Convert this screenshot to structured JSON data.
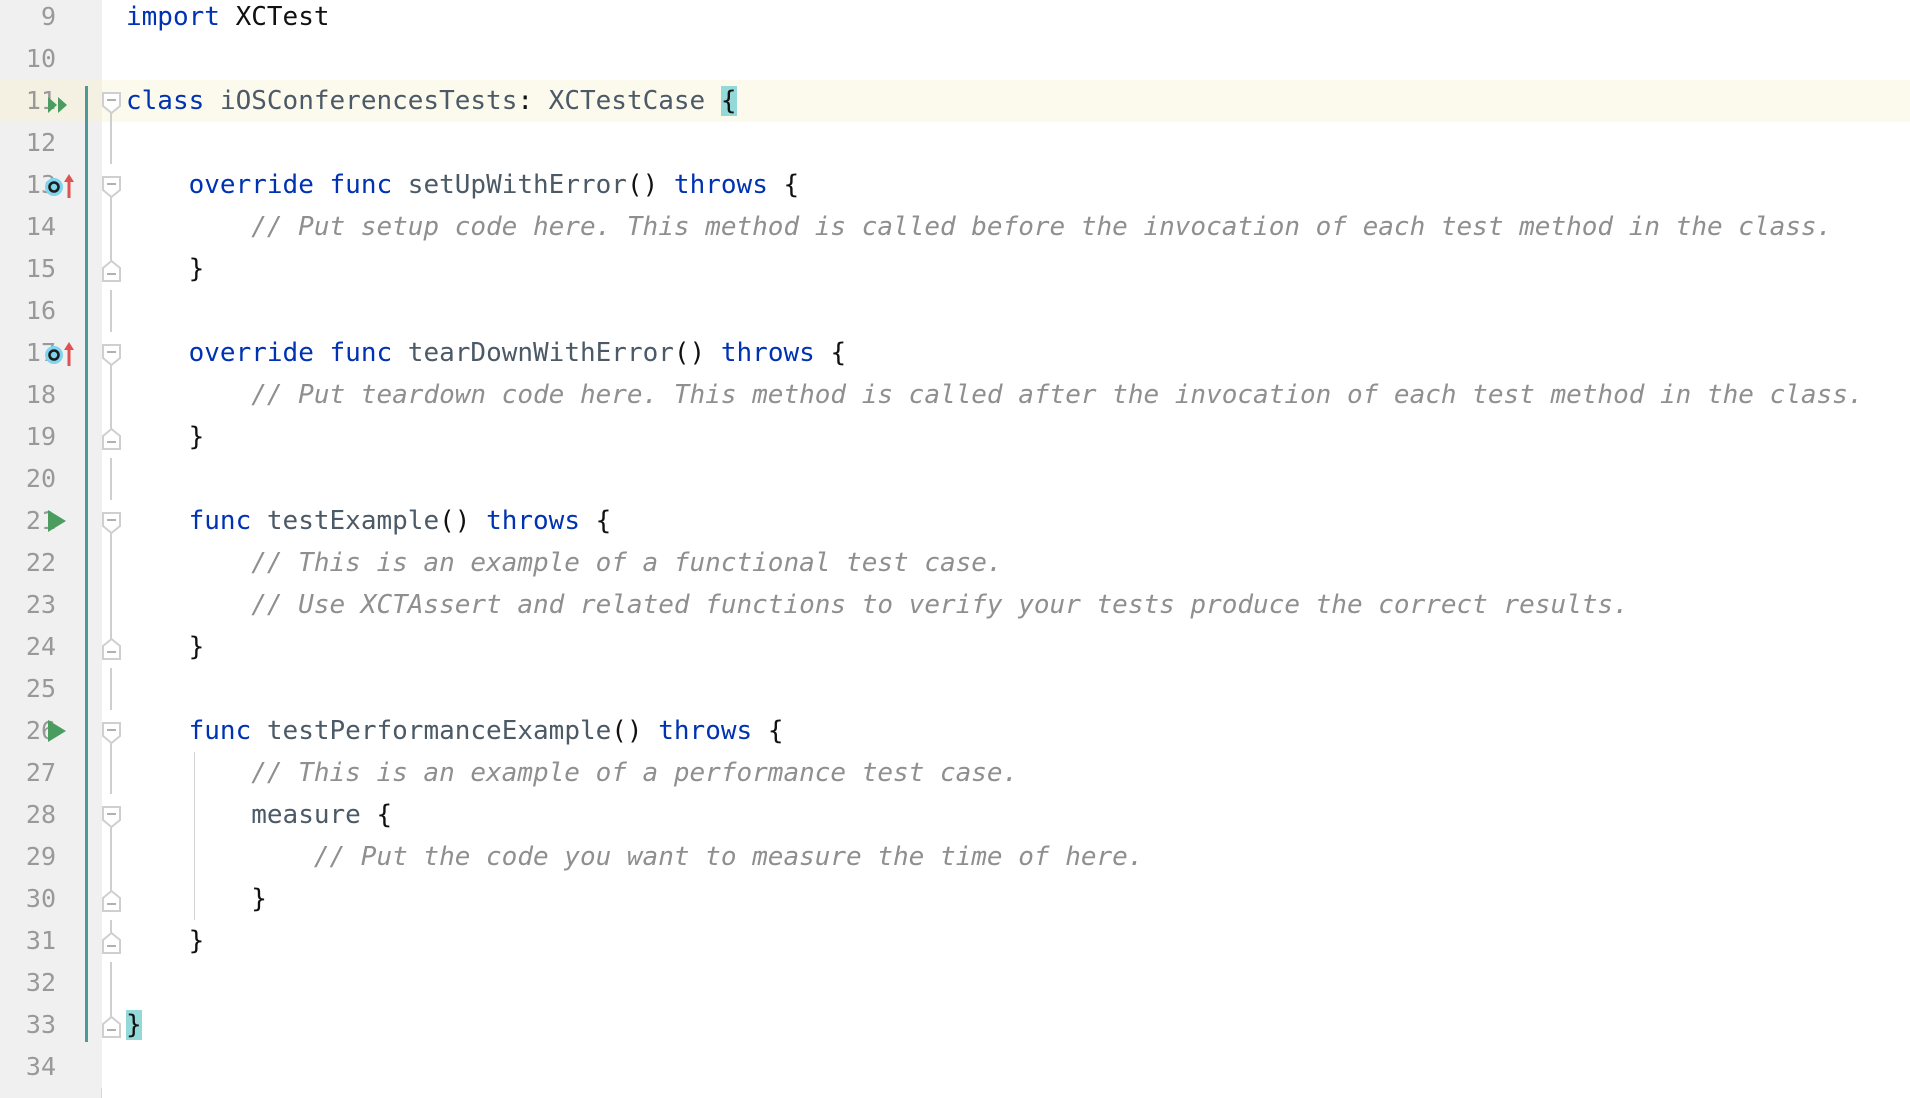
{
  "editor": {
    "language": "Swift",
    "first_visible_line": 9,
    "last_visible_line": 34,
    "current_line": 11,
    "colors": {
      "gutter_bg": "#f0f0f0",
      "code_bg": "#ffffff",
      "line_number": "#999999",
      "keyword": "#0033b3",
      "identifier": "#4b5a66",
      "comment": "#8f8f8f",
      "current_line_highlight": "#fcfaed",
      "matching_brace_highlight": "#93d9d9",
      "vcs_change_marker": "#4a9a9a",
      "fold_marker": "#cfcfcf",
      "run_icon_green": "#4a9c5f",
      "override_icon_cyan": "#59c3e3",
      "override_arrow_red": "#e05252"
    }
  },
  "lines": [
    {
      "number": "9",
      "indent": 0,
      "icon": null,
      "fold": null,
      "vcs": false,
      "current": false,
      "tokens": [
        {
          "t": "import",
          "c": "kw"
        },
        {
          "t": " ",
          "c": "plain"
        },
        {
          "t": "XCTest",
          "c": "plain"
        }
      ]
    },
    {
      "number": "10",
      "indent": 0,
      "icon": null,
      "fold": null,
      "vcs": false,
      "current": false,
      "tokens": []
    },
    {
      "number": "11",
      "indent": 0,
      "icon": "run-all-tests-icon",
      "fold": "start",
      "vcs": true,
      "current": true,
      "tokens": [
        {
          "t": "class",
          "c": "kw"
        },
        {
          "t": " ",
          "c": "plain"
        },
        {
          "t": "iOSConferencesTests",
          "c": "id"
        },
        {
          "t": ":",
          "c": "punc"
        },
        {
          "t": " ",
          "c": "plain"
        },
        {
          "t": "XCTestCase",
          "c": "type"
        },
        {
          "t": " ",
          "c": "plain"
        },
        {
          "t": "{",
          "c": "brace-hl"
        }
      ]
    },
    {
      "number": "12",
      "indent": 0,
      "icon": null,
      "fold": "mid",
      "vcs": true,
      "current": false,
      "tokens": []
    },
    {
      "number": "13",
      "indent": 0,
      "icon": "override-method-icon",
      "fold": "start",
      "vcs": true,
      "current": false,
      "tokens": [
        {
          "t": "    ",
          "c": "plain"
        },
        {
          "t": "override",
          "c": "kw"
        },
        {
          "t": " ",
          "c": "plain"
        },
        {
          "t": "func",
          "c": "kw"
        },
        {
          "t": " ",
          "c": "plain"
        },
        {
          "t": "setUpWithError",
          "c": "id"
        },
        {
          "t": "()",
          "c": "punc"
        },
        {
          "t": " ",
          "c": "plain"
        },
        {
          "t": "throws",
          "c": "kw"
        },
        {
          "t": " ",
          "c": "plain"
        },
        {
          "t": "{",
          "c": "punc"
        }
      ]
    },
    {
      "number": "14",
      "indent": 0,
      "icon": null,
      "fold": "mid",
      "vcs": true,
      "current": false,
      "tokens": [
        {
          "t": "        // Put setup code here. This method is called before the invocation of each test method in the class.",
          "c": "cm"
        }
      ]
    },
    {
      "number": "15",
      "indent": 0,
      "icon": null,
      "fold": "end",
      "vcs": true,
      "current": false,
      "tokens": [
        {
          "t": "    ",
          "c": "plain"
        },
        {
          "t": "}",
          "c": "punc"
        }
      ]
    },
    {
      "number": "16",
      "indent": 0,
      "icon": null,
      "fold": "mid",
      "vcs": true,
      "current": false,
      "tokens": []
    },
    {
      "number": "17",
      "indent": 0,
      "icon": "override-method-icon",
      "fold": "start",
      "vcs": true,
      "current": false,
      "tokens": [
        {
          "t": "    ",
          "c": "plain"
        },
        {
          "t": "override",
          "c": "kw"
        },
        {
          "t": " ",
          "c": "plain"
        },
        {
          "t": "func",
          "c": "kw"
        },
        {
          "t": " ",
          "c": "plain"
        },
        {
          "t": "tearDownWithError",
          "c": "id"
        },
        {
          "t": "()",
          "c": "punc"
        },
        {
          "t": " ",
          "c": "plain"
        },
        {
          "t": "throws",
          "c": "kw"
        },
        {
          "t": " ",
          "c": "plain"
        },
        {
          "t": "{",
          "c": "punc"
        }
      ]
    },
    {
      "number": "18",
      "indent": 0,
      "icon": null,
      "fold": "mid",
      "vcs": true,
      "current": false,
      "tokens": [
        {
          "t": "        // Put teardown code here. This method is called after the invocation of each test method in the class.",
          "c": "cm"
        }
      ]
    },
    {
      "number": "19",
      "indent": 0,
      "icon": null,
      "fold": "end",
      "vcs": true,
      "current": false,
      "tokens": [
        {
          "t": "    ",
          "c": "plain"
        },
        {
          "t": "}",
          "c": "punc"
        }
      ]
    },
    {
      "number": "20",
      "indent": 0,
      "icon": null,
      "fold": "mid",
      "vcs": true,
      "current": false,
      "tokens": []
    },
    {
      "number": "21",
      "indent": 0,
      "icon": "run-test-icon",
      "fold": "start",
      "vcs": true,
      "current": false,
      "tokens": [
        {
          "t": "    ",
          "c": "plain"
        },
        {
          "t": "func",
          "c": "kw"
        },
        {
          "t": " ",
          "c": "plain"
        },
        {
          "t": "testExample",
          "c": "id"
        },
        {
          "t": "()",
          "c": "punc"
        },
        {
          "t": " ",
          "c": "plain"
        },
        {
          "t": "throws",
          "c": "kw"
        },
        {
          "t": " ",
          "c": "plain"
        },
        {
          "t": "{",
          "c": "punc"
        }
      ]
    },
    {
      "number": "22",
      "indent": 0,
      "icon": null,
      "fold": "mid",
      "vcs": true,
      "current": false,
      "tokens": [
        {
          "t": "        // This is an example of a functional test case.",
          "c": "cm"
        }
      ]
    },
    {
      "number": "23",
      "indent": 0,
      "icon": null,
      "fold": "mid",
      "vcs": true,
      "current": false,
      "tokens": [
        {
          "t": "        // Use XCTAssert and related functions to verify your tests produce the correct results.",
          "c": "cm"
        }
      ]
    },
    {
      "number": "24",
      "indent": 0,
      "icon": null,
      "fold": "end",
      "vcs": true,
      "current": false,
      "tokens": [
        {
          "t": "    ",
          "c": "plain"
        },
        {
          "t": "}",
          "c": "punc"
        }
      ]
    },
    {
      "number": "25",
      "indent": 0,
      "icon": null,
      "fold": "mid",
      "vcs": true,
      "current": false,
      "tokens": []
    },
    {
      "number": "26",
      "indent": 0,
      "icon": "run-test-icon",
      "fold": "start",
      "vcs": true,
      "current": false,
      "tokens": [
        {
          "t": "    ",
          "c": "plain"
        },
        {
          "t": "func",
          "c": "kw"
        },
        {
          "t": " ",
          "c": "plain"
        },
        {
          "t": "testPerformanceExample",
          "c": "id"
        },
        {
          "t": "()",
          "c": "punc"
        },
        {
          "t": " ",
          "c": "plain"
        },
        {
          "t": "throws",
          "c": "kw"
        },
        {
          "t": " ",
          "c": "plain"
        },
        {
          "t": "{",
          "c": "punc"
        }
      ]
    },
    {
      "number": "27",
      "indent": 1,
      "icon": null,
      "fold": "mid",
      "vcs": true,
      "current": false,
      "tokens": [
        {
          "t": "        // This is an example of a performance test case.",
          "c": "cm"
        }
      ]
    },
    {
      "number": "28",
      "indent": 1,
      "icon": null,
      "fold": "start",
      "vcs": true,
      "current": false,
      "tokens": [
        {
          "t": "        ",
          "c": "plain"
        },
        {
          "t": "measure",
          "c": "id"
        },
        {
          "t": " ",
          "c": "plain"
        },
        {
          "t": "{",
          "c": "punc"
        }
      ]
    },
    {
      "number": "29",
      "indent": 1,
      "icon": null,
      "fold": "mid",
      "vcs": true,
      "current": false,
      "tokens": [
        {
          "t": "            // Put the code you want to measure the time of here.",
          "c": "cm"
        }
      ]
    },
    {
      "number": "30",
      "indent": 1,
      "icon": null,
      "fold": "end",
      "vcs": true,
      "current": false,
      "tokens": [
        {
          "t": "        ",
          "c": "plain"
        },
        {
          "t": "}",
          "c": "punc"
        }
      ]
    },
    {
      "number": "31",
      "indent": 0,
      "icon": null,
      "fold": "end",
      "vcs": true,
      "current": false,
      "tokens": [
        {
          "t": "    ",
          "c": "plain"
        },
        {
          "t": "}",
          "c": "punc"
        }
      ]
    },
    {
      "number": "32",
      "indent": 0,
      "icon": null,
      "fold": "mid",
      "vcs": true,
      "current": false,
      "tokens": []
    },
    {
      "number": "33",
      "indent": 0,
      "icon": null,
      "fold": "end",
      "vcs": true,
      "current": false,
      "tokens": [
        {
          "t": "}",
          "c": "brace-hl"
        }
      ]
    },
    {
      "number": "34",
      "indent": 0,
      "icon": null,
      "fold": null,
      "vcs": false,
      "current": false,
      "tokens": []
    }
  ]
}
